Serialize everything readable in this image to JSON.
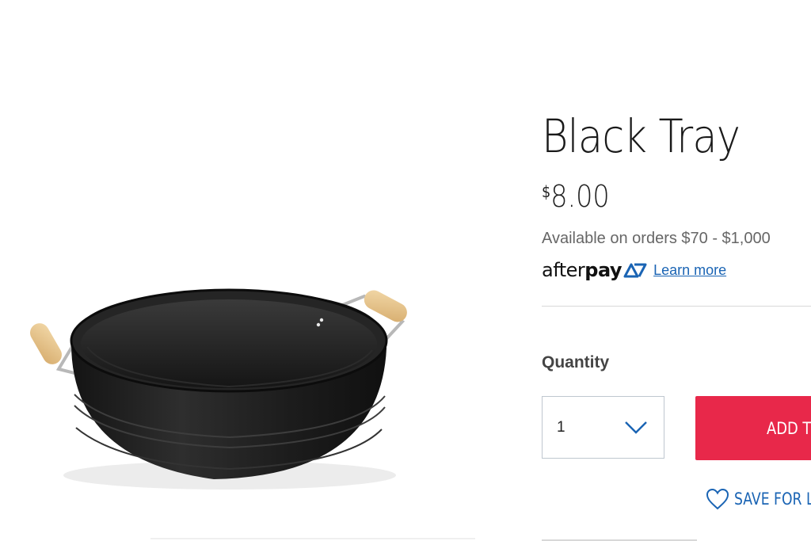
{
  "product": {
    "title": "Black Tray",
    "price_currency": "$",
    "price_amount": "8.00",
    "image_icon": "black-metal-tray-with-wooden-handles"
  },
  "afterpay": {
    "note": "Available on orders $70 - $1,000",
    "logo_text_light": "after",
    "logo_text_bold": "pay",
    "learn_more": "Learn more"
  },
  "purchase": {
    "quantity_label": "Quantity",
    "quantity_value": "1",
    "add_to_cart_label": "ADD TO CART",
    "save_for_later_label": "SAVE FOR LATER"
  },
  "colors": {
    "accent_red": "#e8284a",
    "link_blue": "#1a64b4"
  }
}
